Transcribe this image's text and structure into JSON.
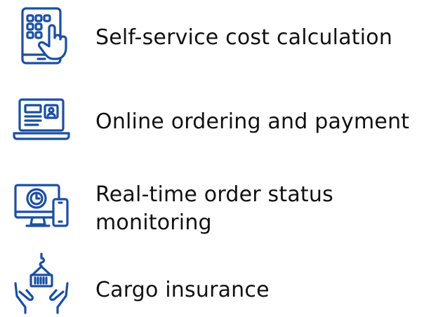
{
  "colors": {
    "icon": "#1a4fa3",
    "text": "#111111",
    "background": "#ffffff"
  },
  "features": [
    {
      "icon": "tablet-touch-icon",
      "lines": [
        "Self-service cost calculation"
      ]
    },
    {
      "icon": "laptop-profile-icon",
      "lines": [
        "Online ordering and payment"
      ]
    },
    {
      "icon": "monitor-clock-phone-icon",
      "lines": [
        "Real-time order status",
        "monitoring"
      ]
    },
    {
      "icon": "hands-cargo-icon",
      "lines": [
        "Cargo insurance"
      ]
    }
  ]
}
